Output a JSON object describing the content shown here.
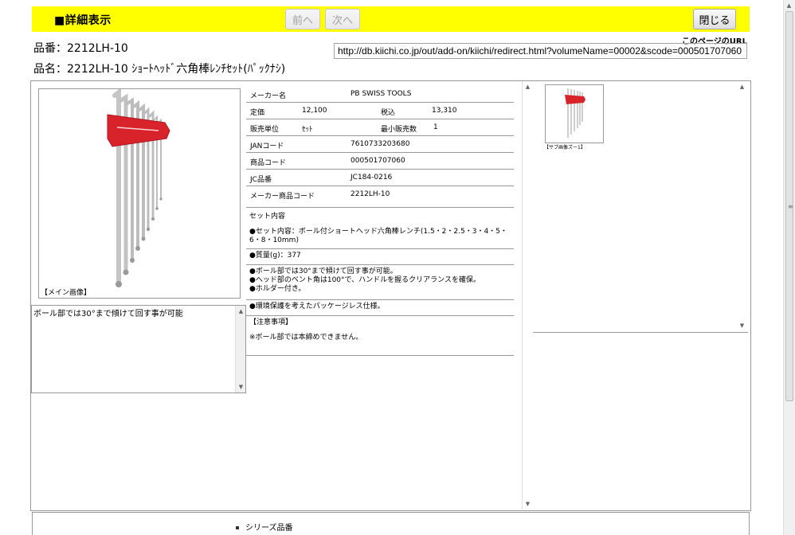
{
  "header": {
    "title": "■詳細表示",
    "prev_label": "前へ",
    "next_label": "次へ",
    "close_label": "閉じる"
  },
  "product": {
    "hinban_line": "品番：2212LH-10",
    "hinmei_line": "品名：2212LH-10 ｼｮｰﾄﾍｯﾄﾞ六角棒ﾚﾝﾁｾｯﾄ(ﾊﾟｯｸﾅｼ)"
  },
  "url": {
    "label": "このページのURL",
    "value": "http://db.kiichi.co.jp/out/add-on/kiichi/redirect.html?volumeName=00002&scode=000501707060"
  },
  "images": {
    "main_caption": "【メイン画像】",
    "thumb_caption": "【サブ画像ズー1】",
    "image_description": "ボール部では30°まで傾けて回す事が可能"
  },
  "spec": {
    "maker_label": "メーカー名",
    "maker_value": "PB SWISS TOOLS",
    "price_label": "定価",
    "price_value": "12,100",
    "tax_label": "税込",
    "tax_value": "13,310",
    "unit_label": "販売単位",
    "unit_value": "ｾｯﾄ",
    "min_label": "最小販売数",
    "min_value": "1",
    "jan_label": "JANコード",
    "jan_value": "7610733203680",
    "code_label": "商品コード",
    "code_value": "000501707060",
    "jc_label": "JC品番",
    "jc_value": "JC184-0216",
    "maker_code_label": "メーカー商品コード",
    "maker_code_value": "2212LH-10"
  },
  "details": {
    "set_heading": "セット内容",
    "set_content": "●セット内容：ボール付ショートヘッド六角棒レンチ(1.5・2・2.5・3・4・5・6・8・10mm)",
    "weight": "●質量(g)：377",
    "feature1": "●ボール部では30°まで傾けて回す事が可能。",
    "feature2": "●ヘッド部のベント角は100°で、ハンドルを握るクリアランスを確保。",
    "feature3": "●ホルダー付き。",
    "eco": "●環境保護を考えたパッケージレス仕様。",
    "caution_heading": "【注意事項】",
    "caution": "※ボール部では本締めできません。"
  },
  "series": {
    "label": "シリーズ品番"
  },
  "colors": {
    "topbar": "#ffff00",
    "holder_red": "#d8232a"
  }
}
